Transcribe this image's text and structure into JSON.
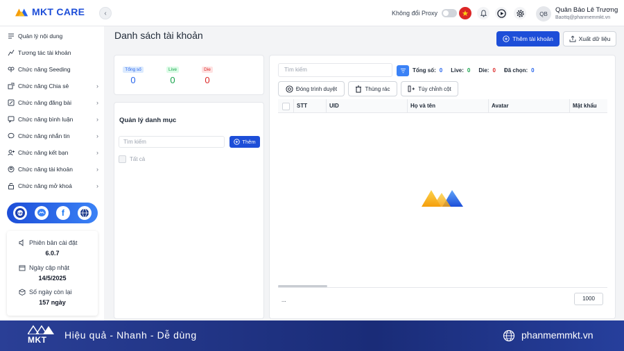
{
  "app": {
    "logo_text": "MKT CARE"
  },
  "header": {
    "proxy_label": "Không đổi Proxy",
    "avatar_initials": "QB",
    "user_name": "Quân Bảo Lê Trương",
    "user_email": "Baottq@phanmemmkt.vn"
  },
  "sidebar": {
    "items": [
      {
        "label": "Quản lý nội dung",
        "icon": "content-icon",
        "has_children": false
      },
      {
        "label": "Tương tác tài khoản",
        "icon": "interact-icon",
        "has_children": false
      },
      {
        "label": "Chức năng Seeding",
        "icon": "seeding-icon",
        "has_children": false
      },
      {
        "label": "Chức năng Chia sẻ",
        "icon": "share-icon",
        "has_children": true
      },
      {
        "label": "Chức năng đăng bài",
        "icon": "post-icon",
        "has_children": true
      },
      {
        "label": "Chức năng bình luận",
        "icon": "comment-icon",
        "has_children": true
      },
      {
        "label": "Chức năng nhắn tin",
        "icon": "message-icon",
        "has_children": true
      },
      {
        "label": "Chức năng kết bạn",
        "icon": "add-friend-icon",
        "has_children": true
      },
      {
        "label": "Chức năng tài khoản",
        "icon": "account-icon",
        "has_children": true
      },
      {
        "label": "Chức năng mở khoá",
        "icon": "unlock-icon",
        "has_children": true
      }
    ],
    "socials": [
      "support-icon",
      "messenger-icon",
      "facebook-icon",
      "website-icon"
    ],
    "info": {
      "version_label": "Phiên bản cài đặt",
      "version_value": "6.0.7",
      "update_label": "Ngày cập nhật",
      "update_value": "14/5/2025",
      "days_label": "Số ngày còn lại",
      "days_value": "157 ngày"
    }
  },
  "main": {
    "title": "Danh sách tài khoản",
    "add_account_button": "Thêm tài khoản",
    "export_button": "Xuất dữ liệu",
    "stats": [
      {
        "label": "Tổng số",
        "value": "0",
        "color": "#2563eb",
        "bg": "#dbeafe"
      },
      {
        "label": "Live",
        "value": "0",
        "color": "#16a34a",
        "bg": "#dcfce7"
      },
      {
        "label": "Die",
        "value": "0",
        "color": "#dc2626",
        "bg": "#fee2e2"
      }
    ],
    "category": {
      "title": "Quản lý danh mục",
      "search_placeholder": "Tìm kiếm",
      "add_button": "Thêm",
      "select_all": "Tất cả"
    },
    "accounts": {
      "search_placeholder": "Tìm kiếm",
      "total_label": "Tổng số:",
      "total_value": "0",
      "live_label": "Live:",
      "live_value": "0",
      "die_label": "Die:",
      "die_value": "0",
      "selected_label": "Đã chọn:",
      "selected_value": "0",
      "close_browser_button": "Đóng trình duyệt",
      "trash_button": "Thùng rác",
      "columns_button": "Tùy chỉnh cột",
      "columns": [
        "STT",
        "UID",
        "Họ và tên",
        "Avatar",
        "Mật khẩu"
      ],
      "pagination_text": "...",
      "page_size": "1000"
    }
  },
  "footer": {
    "logo_text": "MKT",
    "slogan": "Hiệu quả - Nhanh - Dễ dùng",
    "website": "phanmemmkt.vn"
  },
  "colors": {
    "primary": "#1d4ed8",
    "logo_orange": "#f59e0b",
    "logo_blue": "#2563eb",
    "banner": "#1a2c78"
  }
}
